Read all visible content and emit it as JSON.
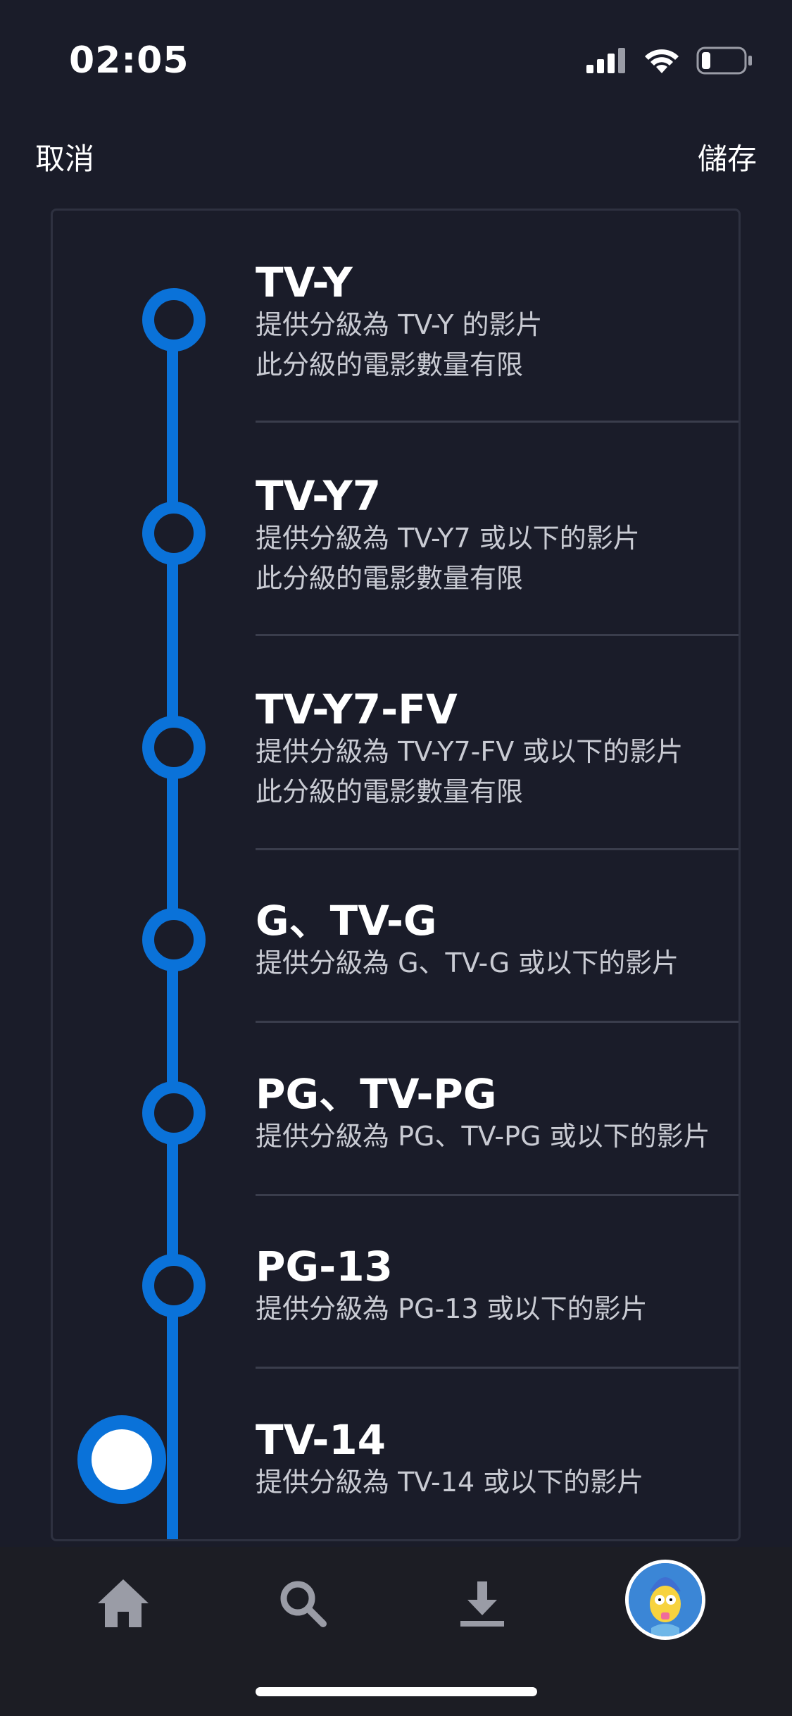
{
  "status_bar": {
    "time": "02:05",
    "icons": [
      "signal-icon",
      "wifi-icon",
      "battery-icon"
    ]
  },
  "nav": {
    "cancel_label": "取消",
    "save_label": "儲存"
  },
  "ratings": [
    {
      "title": "TV-Y",
      "desc1": "提供分級為 TV-Y 的影片",
      "desc2": "此分級的電影數量有限"
    },
    {
      "title": "TV-Y7",
      "desc1": "提供分級為 TV-Y7 或以下的影片",
      "desc2": "此分級的電影數量有限"
    },
    {
      "title": "TV-Y7-FV",
      "desc1": "提供分級為 TV-Y7-FV 或以下的影片",
      "desc2": "此分級的電影數量有限"
    },
    {
      "title": "G、TV-G",
      "desc1": "提供分級為 G、TV-G 或以下的影片"
    },
    {
      "title": "PG、TV-PG",
      "desc1": "提供分級為 PG、TV-PG 或以下的影片"
    },
    {
      "title": "PG-13",
      "desc1": "提供分級為 PG-13 或以下的影片"
    },
    {
      "title": "TV-14",
      "desc1": "提供分級為 TV-14 或以下的影片"
    }
  ],
  "selected_rating": "TV-14",
  "tabbar": {
    "tabs": [
      "home-icon",
      "search-icon",
      "download-icon",
      "profile-avatar"
    ]
  },
  "colors": {
    "background": "#1a1c29",
    "accent": "#0a72d9",
    "divider": "#3a3d4c",
    "secondary_text": "#c9cbd3"
  }
}
